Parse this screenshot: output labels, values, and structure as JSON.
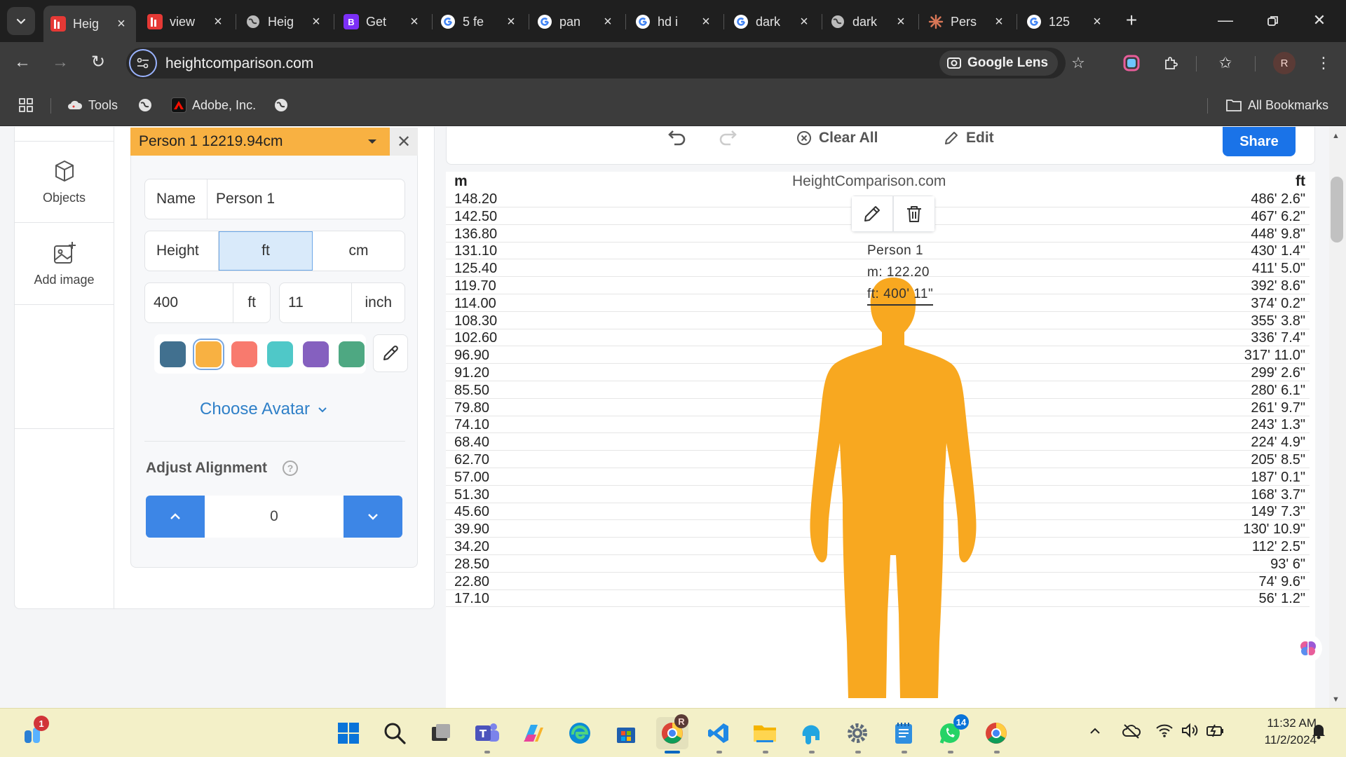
{
  "browser": {
    "tabs": [
      {
        "title": "Heig",
        "favicon": "heightcomparison-favicon",
        "color": "#e53935",
        "active": true
      },
      {
        "title": "view",
        "favicon": "heightcomparison-favicon",
        "color": "#e53935",
        "active": false
      },
      {
        "title": "Heig",
        "favicon": "globe-favicon",
        "color": "#888888",
        "active": false
      },
      {
        "title": "Get",
        "favicon": "bootstrap-favicon",
        "color": "#7b2ff7",
        "active": false
      },
      {
        "title": "5 fe",
        "favicon": "google-favicon",
        "color": "#4285f4",
        "active": false
      },
      {
        "title": "pan",
        "favicon": "google-favicon",
        "color": "#4285f4",
        "active": false
      },
      {
        "title": "hd i",
        "favicon": "google-favicon",
        "color": "#4285f4",
        "active": false
      },
      {
        "title": "dark",
        "favicon": "google-favicon",
        "color": "#4285f4",
        "active": false
      },
      {
        "title": "dark",
        "favicon": "globe-favicon",
        "color": "#888888",
        "active": false
      },
      {
        "title": "Pers",
        "favicon": "claude-favicon",
        "color": "#d97757",
        "active": false
      },
      {
        "title": "125",
        "favicon": "google-favicon",
        "color": "#4285f4",
        "active": false
      }
    ],
    "url": "heightcomparison.com",
    "lens_label": "Google Lens",
    "profile_initial": "R",
    "bookmarks": [
      {
        "label": "Tools",
        "icon": "cloud-icon"
      },
      {
        "label": "",
        "icon": "globe-icon"
      },
      {
        "label": "Adobe, Inc.",
        "icon": "adobe-icon"
      },
      {
        "label": "",
        "icon": "globe-icon"
      }
    ],
    "all_bookmarks_label": "All Bookmarks"
  },
  "sidebar": {
    "items": [
      {
        "label": "Objects",
        "icon": "cube-icon"
      },
      {
        "label": "Add image",
        "icon": "add-image-icon"
      }
    ]
  },
  "panel": {
    "header": "Person 1 12219.94cm",
    "name_label": "Name",
    "name_value": "Person 1",
    "height_label": "Height",
    "unit_ft": "ft",
    "unit_cm": "cm",
    "selected_unit": "ft",
    "feet_value": "400",
    "feet_unit": "ft",
    "inch_value": "11",
    "inch_unit": "inch",
    "colors": [
      "#41708f",
      "#f8b142",
      "#f87a6e",
      "#4fc8c8",
      "#8560bf",
      "#4ea882"
    ],
    "selected_color_index": 1,
    "choose_avatar": "Choose Avatar",
    "adjust_alignment": "Adjust Alignment",
    "help_glyph": "?",
    "alignment_value": "0"
  },
  "chart_toolbar": {
    "clear_all": "Clear All",
    "edit": "Edit",
    "share": "Share"
  },
  "chart_data": {
    "type": "table",
    "left_unit": "m",
    "right_unit": "ft",
    "brand": "HeightComparison.com",
    "ticks_m": [
      "148.20",
      "142.50",
      "136.80",
      "131.10",
      "125.40",
      "119.70",
      "114.00",
      "108.30",
      "102.60",
      "96.90",
      "91.20",
      "85.50",
      "79.80",
      "74.10",
      "68.40",
      "62.70",
      "57.00",
      "51.30",
      "45.60",
      "39.90",
      "34.20",
      "28.50",
      "22.80",
      "17.10"
    ],
    "ticks_ft": [
      "486' 2.6\"",
      "467' 6.2\"",
      "448' 9.8\"",
      "430' 1.4\"",
      "411' 5.0\"",
      "392' 8.6\"",
      "374' 0.2\"",
      "355' 3.8\"",
      "336' 7.4\"",
      "317' 11.0\"",
      "299' 2.6\"",
      "280' 6.1\"",
      "261' 9.7\"",
      "243' 1.3\"",
      "224' 4.9\"",
      "205' 8.5\"",
      "187' 0.1\"",
      "168' 3.7\"",
      "149' 7.3\"",
      "130' 10.9\"",
      "112' 2.5\"",
      "93' 6\"",
      "74' 9.6\"",
      "56' 1.2\""
    ],
    "person": {
      "name": "Person 1",
      "m_line": "m: 122.20",
      "ft_line": "ft: 400' 11\"",
      "height_m": 122.2,
      "color": "#f8a820"
    }
  },
  "taskbar": {
    "notification_count": "1",
    "whatsapp_count": "14",
    "chrome_profile": "R",
    "time": "11:32 AM",
    "date": "11/2/2024"
  }
}
